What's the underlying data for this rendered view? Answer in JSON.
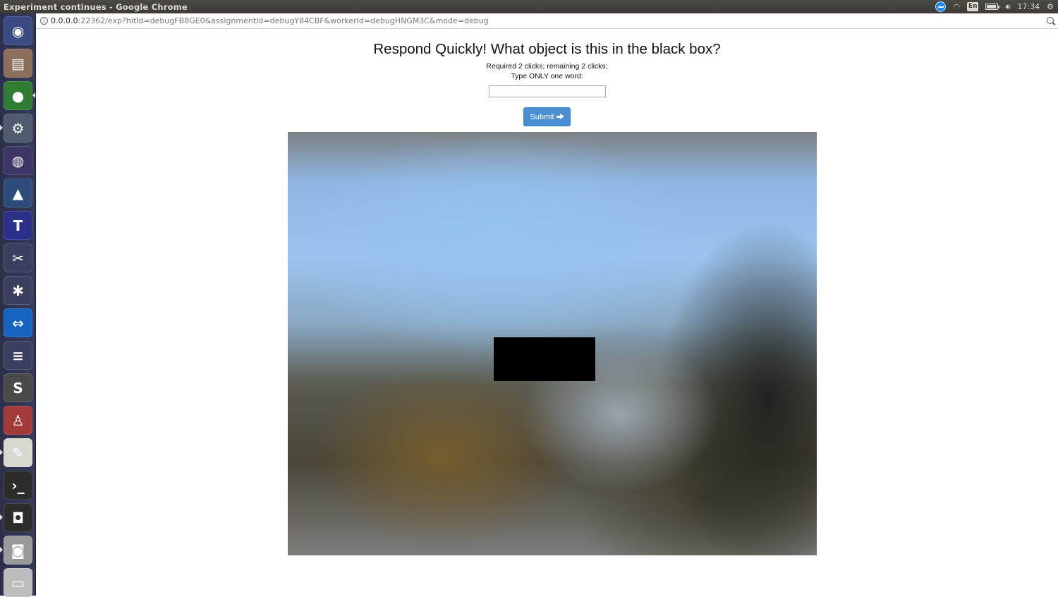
{
  "window": {
    "title": "Experiment continues - Google Chrome"
  },
  "tray": {
    "lang": "En",
    "time": "17:34"
  },
  "address": {
    "host": "0.0.0.0",
    "path": ":22362/exp?hitId=debugFB8GE0&assignmentId=debugY84CBF&workerId=debugHNGM3C&mode=debug"
  },
  "page": {
    "heading": "Respond Quickly! What object is this in the black box?",
    "clicks_line": "Required 2 clicks; remaining 2 clicks;",
    "instruction": "Type ONLY one word:",
    "input_value": "",
    "submit_label": "Submit"
  },
  "launcher": {
    "items": [
      {
        "name": "ubuntu-dash",
        "color": "#3b4a82",
        "glyph": "◉"
      },
      {
        "name": "files",
        "color": "#8b6f5a",
        "glyph": "▤"
      },
      {
        "name": "chrome",
        "color": "#2e7d32",
        "glyph": "●"
      },
      {
        "name": "system-settings",
        "color": "#4e5a6e",
        "glyph": "⚙"
      },
      {
        "name": "eclipse",
        "color": "#3d3566",
        "glyph": "◍"
      },
      {
        "name": "matlab",
        "color": "#2d4c7a",
        "glyph": "▲"
      },
      {
        "name": "texmaker",
        "color": "#2b2f8a",
        "glyph": "T"
      },
      {
        "name": "scissors",
        "color": "#3a3f5e",
        "glyph": "✂"
      },
      {
        "name": "webcam-tool",
        "color": "#3a3f5e",
        "glyph": "✱"
      },
      {
        "name": "teamviewer",
        "color": "#1565c0",
        "glyph": "⇔"
      },
      {
        "name": "stack-app",
        "color": "#3a3f5e",
        "glyph": "≡"
      },
      {
        "name": "sublime-text",
        "color": "#4a4a4a",
        "glyph": "S"
      },
      {
        "name": "wine",
        "color": "#a33a3a",
        "glyph": "♙"
      },
      {
        "name": "text-editor",
        "color": "#d8d8d0",
        "glyph": "✎"
      },
      {
        "name": "terminal",
        "color": "#2c2c2c",
        "glyph": "›_"
      },
      {
        "name": "speaker-app",
        "color": "#2c2c2c",
        "glyph": "◘"
      },
      {
        "name": "screenshot-camera",
        "color": "#9a9a9a",
        "glyph": "◙"
      },
      {
        "name": "drive",
        "color": "#bdbdbd",
        "glyph": "▭"
      }
    ]
  }
}
